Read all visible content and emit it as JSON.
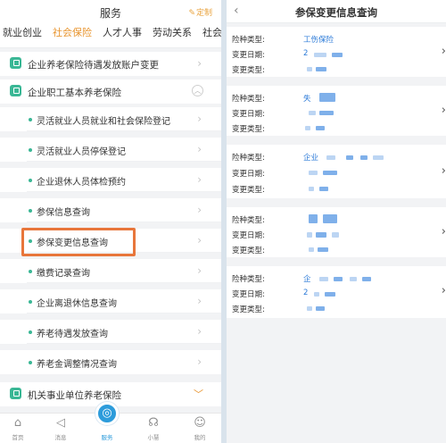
{
  "left": {
    "header_title": "服务",
    "custom_label": "定制",
    "tabs": [
      "就业创业",
      "社会保险",
      "人才人事",
      "劳动关系",
      "社会保"
    ],
    "active_tab": 1,
    "items": [
      {
        "kind": "group",
        "label": "企业养老保险待遇发放账户变更"
      },
      {
        "kind": "group",
        "label": "企业职工基本养老保险"
      },
      {
        "kind": "sub",
        "label": "灵活就业人员就业和社会保险登记"
      },
      {
        "kind": "sub",
        "label": "灵活就业人员停保登记"
      },
      {
        "kind": "sub",
        "label": "企业退休人员体检预约"
      },
      {
        "kind": "sub",
        "label": "参保信息查询"
      },
      {
        "kind": "sub",
        "label": "参保变更信息查询"
      },
      {
        "kind": "sub",
        "label": "缴费记录查询"
      },
      {
        "kind": "sub",
        "label": "企业离退休信息查询"
      },
      {
        "kind": "sub",
        "label": "养老待遇发放查询"
      },
      {
        "kind": "sub",
        "label": "养老金调整情况查询"
      },
      {
        "kind": "group",
        "label": "机关事业单位养老保险"
      }
    ],
    "bottom_nav": [
      "首页",
      "消息",
      "服务",
      "小慧",
      "我的"
    ]
  },
  "right": {
    "header_title": "参保变更信息查询",
    "labels": {
      "type": "险种类型:",
      "date": "变更日期:",
      "kind": "变更类型:"
    },
    "cards": [
      {
        "type_value": "工伤保险",
        "date_value": "2"
      },
      {
        "type_value": "失",
        "date_value": ""
      },
      {
        "type_value": "企业",
        "date_value": ""
      },
      {
        "type_value": "",
        "date_value": ""
      },
      {
        "type_value": "企",
        "date_value": "2"
      }
    ]
  },
  "colors": {
    "accent": "#e8952f",
    "green": "#3ab795",
    "blue": "#2d7bd8",
    "highlight": "#e8763b"
  }
}
